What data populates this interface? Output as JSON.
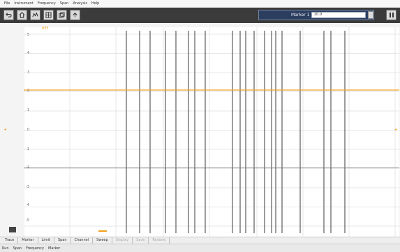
{
  "menu": {
    "items": [
      "File",
      "Instrument",
      "Frequency",
      "Span",
      "Analysis",
      "Help"
    ]
  },
  "toolbar": {
    "buttons": [
      "undo-icon",
      "home-icon",
      "trace-icon",
      "grid-icon",
      "layers-icon",
      "upload-icon"
    ],
    "marker_label": "Marker 1",
    "marker_value": "20.0",
    "pause_icon": "pause-icon"
  },
  "plot": {
    "header": {
      "left": "REF",
      "center": "",
      "mid": ""
    },
    "y_labels": [
      "5",
      "4",
      "3",
      "2",
      "1",
      "0",
      "-1",
      "-2",
      "-3",
      "-4",
      "-5"
    ],
    "cursor_rows": [],
    "bottom_left": "",
    "bottom_right": "",
    "trace_color": "#f0a020",
    "grid_color": "#cfcfcf",
    "dark_line_color": "#3a3a3a"
  },
  "tabs": [
    {
      "label": "Trace",
      "disabled": false
    },
    {
      "label": "Marker",
      "disabled": false
    },
    {
      "label": "Limit",
      "disabled": false
    },
    {
      "label": "Span",
      "disabled": false
    },
    {
      "label": "Channel",
      "disabled": false
    },
    {
      "label": "Sweep",
      "disabled": false
    },
    {
      "label": "Display",
      "disabled": true
    },
    {
      "label": "Save",
      "disabled": true
    },
    {
      "label": "Restore",
      "disabled": true
    }
  ],
  "status": {
    "left_items": [
      "Run",
      "Span",
      "Frequency",
      "Marker"
    ],
    "right": ""
  }
}
